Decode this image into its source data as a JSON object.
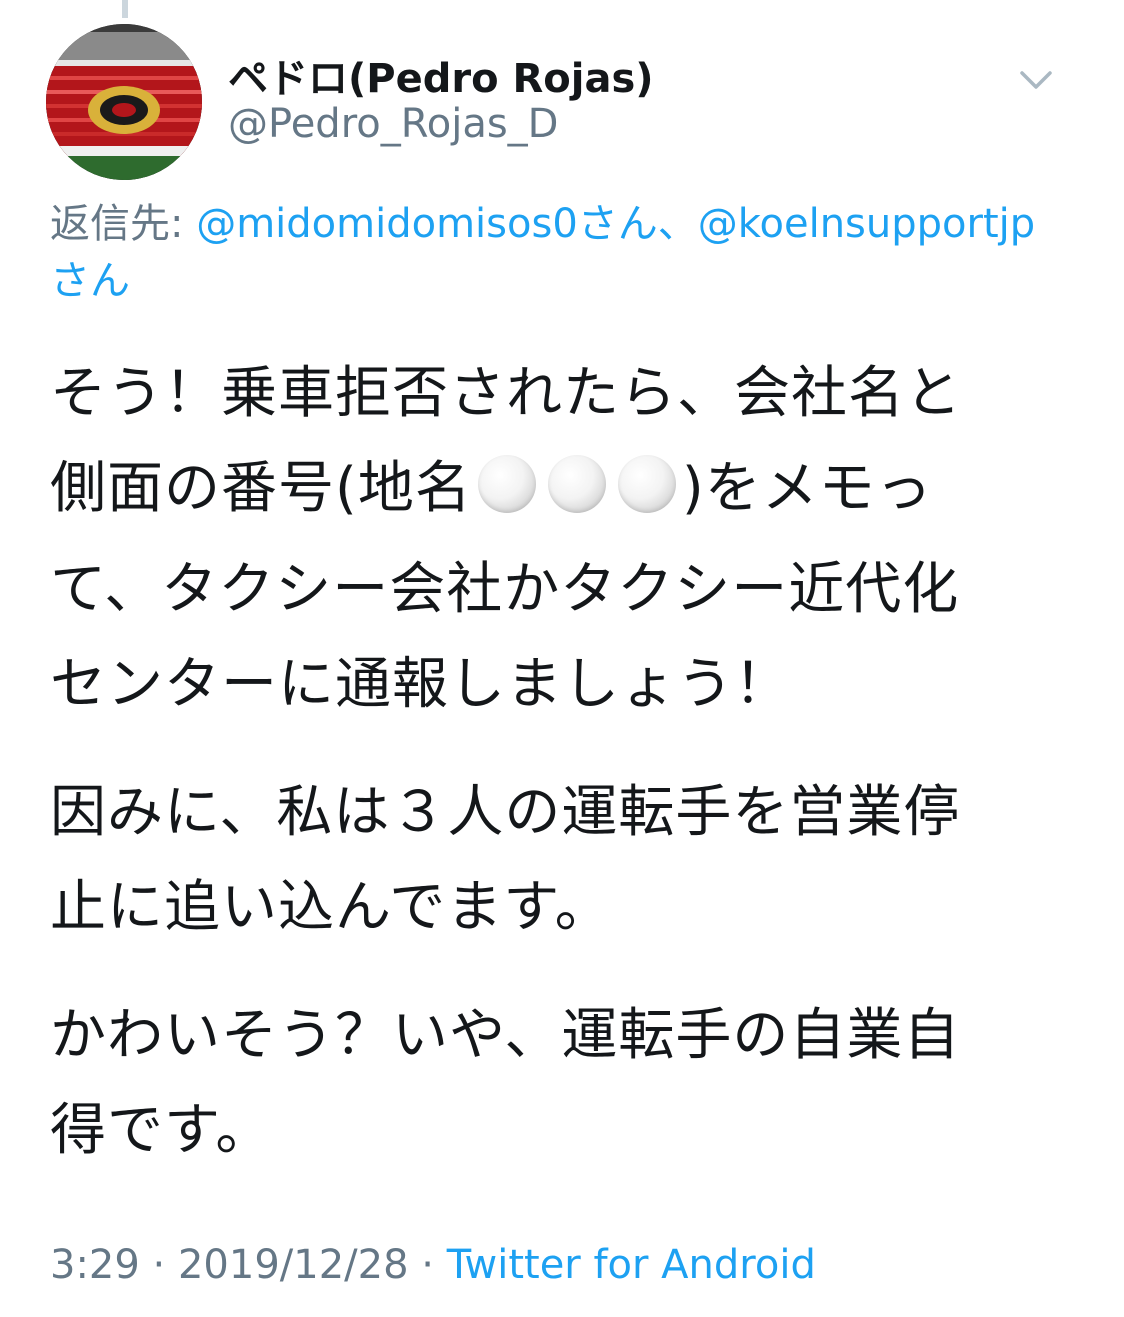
{
  "tweet": {
    "display_name": "ペドロ(Pedro Rojas)",
    "handle": "@Pedro_Rojas_D",
    "reply_prefix": "返信先: ",
    "mention_1": "@midomidomisos0さん",
    "mention_sep": "、",
    "mention_2": "@koelnsupportjp",
    "mention_2_suffix": "さん",
    "body": {
      "p1_l1": "そう！乗車拒否されたら、会社名と",
      "p1_l2_pre": "側面の番号(地名",
      "p1_l2_post": ")をメモっ",
      "p1_l3": "て、タクシー会社かタクシー近代化",
      "p1_l4": "センターに通報しましょう！",
      "p2_l1": "因みに、私は３人の運転手を営業停",
      "p2_l2": "止に追い込んでます。",
      "p3_l1": "かわいそう？いや、運転手の自業自",
      "p3_l2": "得です。"
    },
    "time": "3:29",
    "sep": " · ",
    "date": "2019/12/28",
    "source": "Twitter for Android"
  },
  "icons": {
    "menu": "chevron-down-icon",
    "placeholder": "white-circle-emoji"
  },
  "colors": {
    "text": "#14171a",
    "secondary": "#657786",
    "link": "#1da1f2"
  }
}
